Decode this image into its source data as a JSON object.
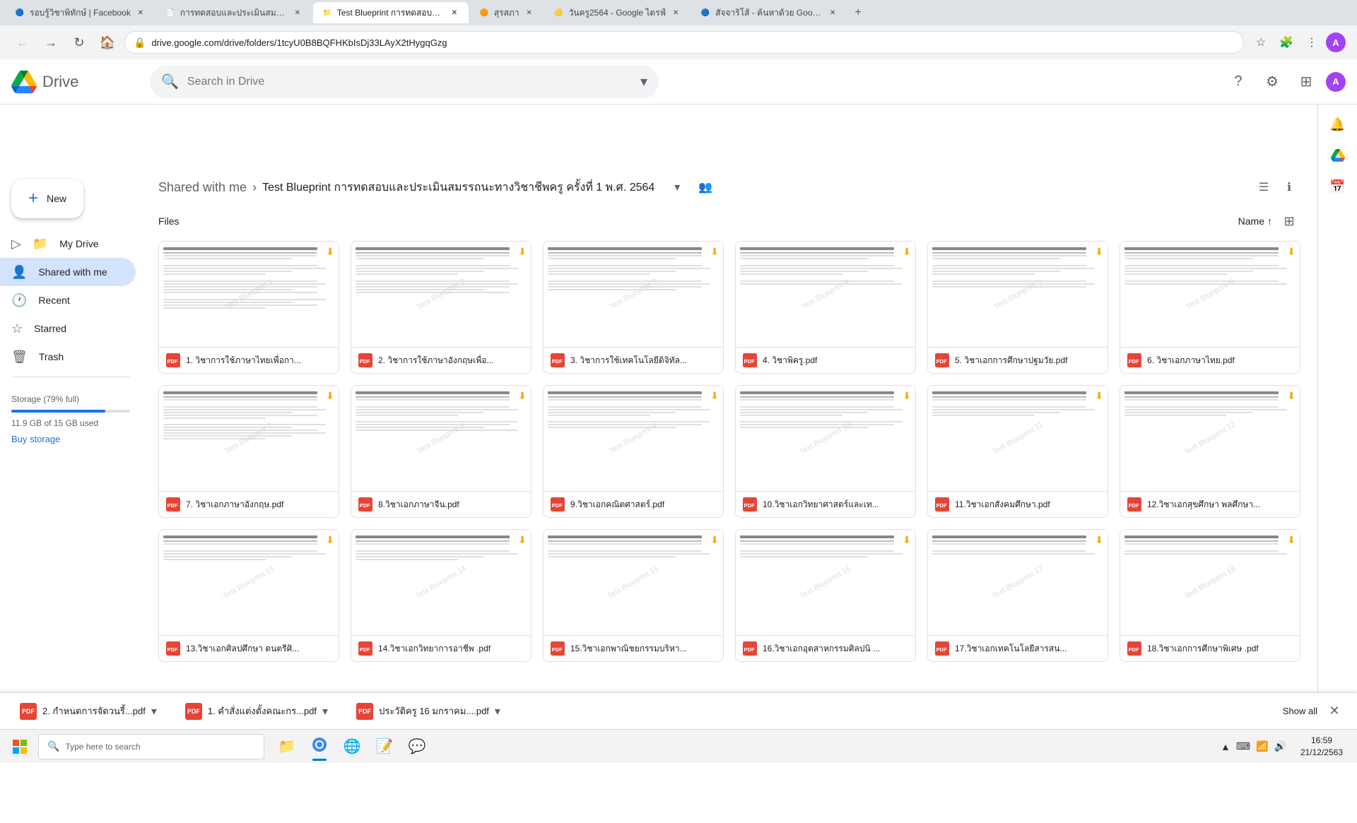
{
  "browser": {
    "tabs": [
      {
        "id": "tab1",
        "title": "รอบรู้วิชาพิทักษ์ | Facebook",
        "favicon": "🔵",
        "active": false,
        "closable": true
      },
      {
        "id": "tab2",
        "title": "การทดสอบและประเมินสมรรถนะ...",
        "favicon": "📄",
        "active": false,
        "closable": true
      },
      {
        "id": "tab3",
        "title": "Test Blueprint การทดสอบและประเมิน...",
        "favicon": "📁",
        "active": true,
        "closable": true
      },
      {
        "id": "tab4",
        "title": "สุรสภา",
        "favicon": "🟠",
        "active": false,
        "closable": true
      },
      {
        "id": "tab5",
        "title": "วันครู2564 - Google ไดรฟ์",
        "favicon": "🟡",
        "active": false,
        "closable": true
      },
      {
        "id": "tab6",
        "title": "สัจจาริโส้ - ค้นหาด้วย Google",
        "favicon": "🔵",
        "active": false,
        "closable": true
      }
    ],
    "url": "drive.google.com/drive/folders/1tcyU0B8BQFHKbIsDj33LAyX2tHygqGzg",
    "profile_initial": "A"
  },
  "app_header": {
    "logo_text": "Drive",
    "search_placeholder": "Search in Drive",
    "header_icons": [
      "help-outline",
      "settings",
      "apps",
      "account"
    ]
  },
  "sidebar": {
    "new_button_label": "New",
    "items": [
      {
        "id": "my-drive",
        "label": "My Drive",
        "icon": "folder",
        "active": false
      },
      {
        "id": "shared-with-me",
        "label": "Shared with me",
        "icon": "person",
        "active": true
      },
      {
        "id": "recent",
        "label": "Recent",
        "icon": "clock",
        "active": false
      },
      {
        "id": "starred",
        "label": "Starred",
        "icon": "star",
        "active": false
      },
      {
        "id": "trash",
        "label": "Trash",
        "icon": "trash",
        "active": false
      }
    ],
    "storage": {
      "label": "Storage (79% full)",
      "used": "11.9 GB of 15 GB used",
      "percent": 79,
      "buy_label": "Buy storage"
    }
  },
  "breadcrumb": {
    "parent": "Shared with me",
    "current": "Test Blueprint การทดสอบและประเมินสมรรถนะทางวิชาชีพครู ครั้งที่ 1 พ.ศ. 2564"
  },
  "content": {
    "section_title": "Files",
    "sort_label": "Name",
    "files": [
      {
        "id": 1,
        "name": "1. วิชาการใช้ภาษาไทยเพื่อกา..."
      },
      {
        "id": 2,
        "name": "2. วิชาการใช้ภาษาอังกฤษเพื่อ..."
      },
      {
        "id": 3,
        "name": "3. วิชาการใช้เทคโนโลยีดิจิทัล..."
      },
      {
        "id": 4,
        "name": "4. วิชาพิครู.pdf"
      },
      {
        "id": 5,
        "name": "5. วิชาเอกการศึกษาปฐมวัย.pdf"
      },
      {
        "id": 6,
        "name": "6. วิชาเอกภาษาไทย.pdf"
      },
      {
        "id": 7,
        "name": "7. วิชาเอกภาษาอังกฤษ.pdf"
      },
      {
        "id": 8,
        "name": "8.วิชาเอกภาษาจีน.pdf"
      },
      {
        "id": 9,
        "name": "9.วิชาเอกคณิตศาสตร์.pdf"
      },
      {
        "id": 10,
        "name": "10.วิชาเอกวิทยาศาสตร์และเท..."
      },
      {
        "id": 11,
        "name": "11.วิชาเอกสังคมศึกษา.pdf"
      },
      {
        "id": 12,
        "name": "12.วิชาเอกสุขศึกษา พลศึกษา..."
      },
      {
        "id": 13,
        "name": "13.วิชาเอกศิลปศึกษา ดนตรีศิ..."
      },
      {
        "id": 14,
        "name": "14.วิชาเอกวิทยาการอาชีพ .pdf"
      },
      {
        "id": 15,
        "name": "15.วิชาเอกพาณิชยกรรมบริหา..."
      },
      {
        "id": 16,
        "name": "16.วิชาเอกอุตสาหกรรมศิลปนิ ..."
      },
      {
        "id": 17,
        "name": "17.วิชาเอกเทคโนโลยีสารสน..."
      },
      {
        "id": 18,
        "name": "18.วิชาเอกการศึกษาพิเศษ .pdf"
      }
    ]
  },
  "download_bar": {
    "items": [
      {
        "id": "dl1",
        "name": "2. กำหนดการจัดวนรี้...pdf"
      },
      {
        "id": "dl2",
        "name": "1. คำสั่งแต่งตั้งคณะกร...pdf"
      },
      {
        "id": "dl3",
        "name": "ประวัติครู 16 มกราคม....pdf"
      }
    ],
    "show_all_label": "Show all",
    "close_label": "×"
  },
  "taskbar": {
    "search_placeholder": "Type here to search",
    "time": "16:59",
    "date": "21/12/2563",
    "apps": [
      "file-explorer",
      "chrome",
      "edge",
      "word",
      "line"
    ]
  },
  "colors": {
    "accent": "#1a73e8",
    "pdf_red": "#ea4335",
    "gold": "#f9ab00",
    "sidebar_active_bg": "#d3e3fd"
  }
}
